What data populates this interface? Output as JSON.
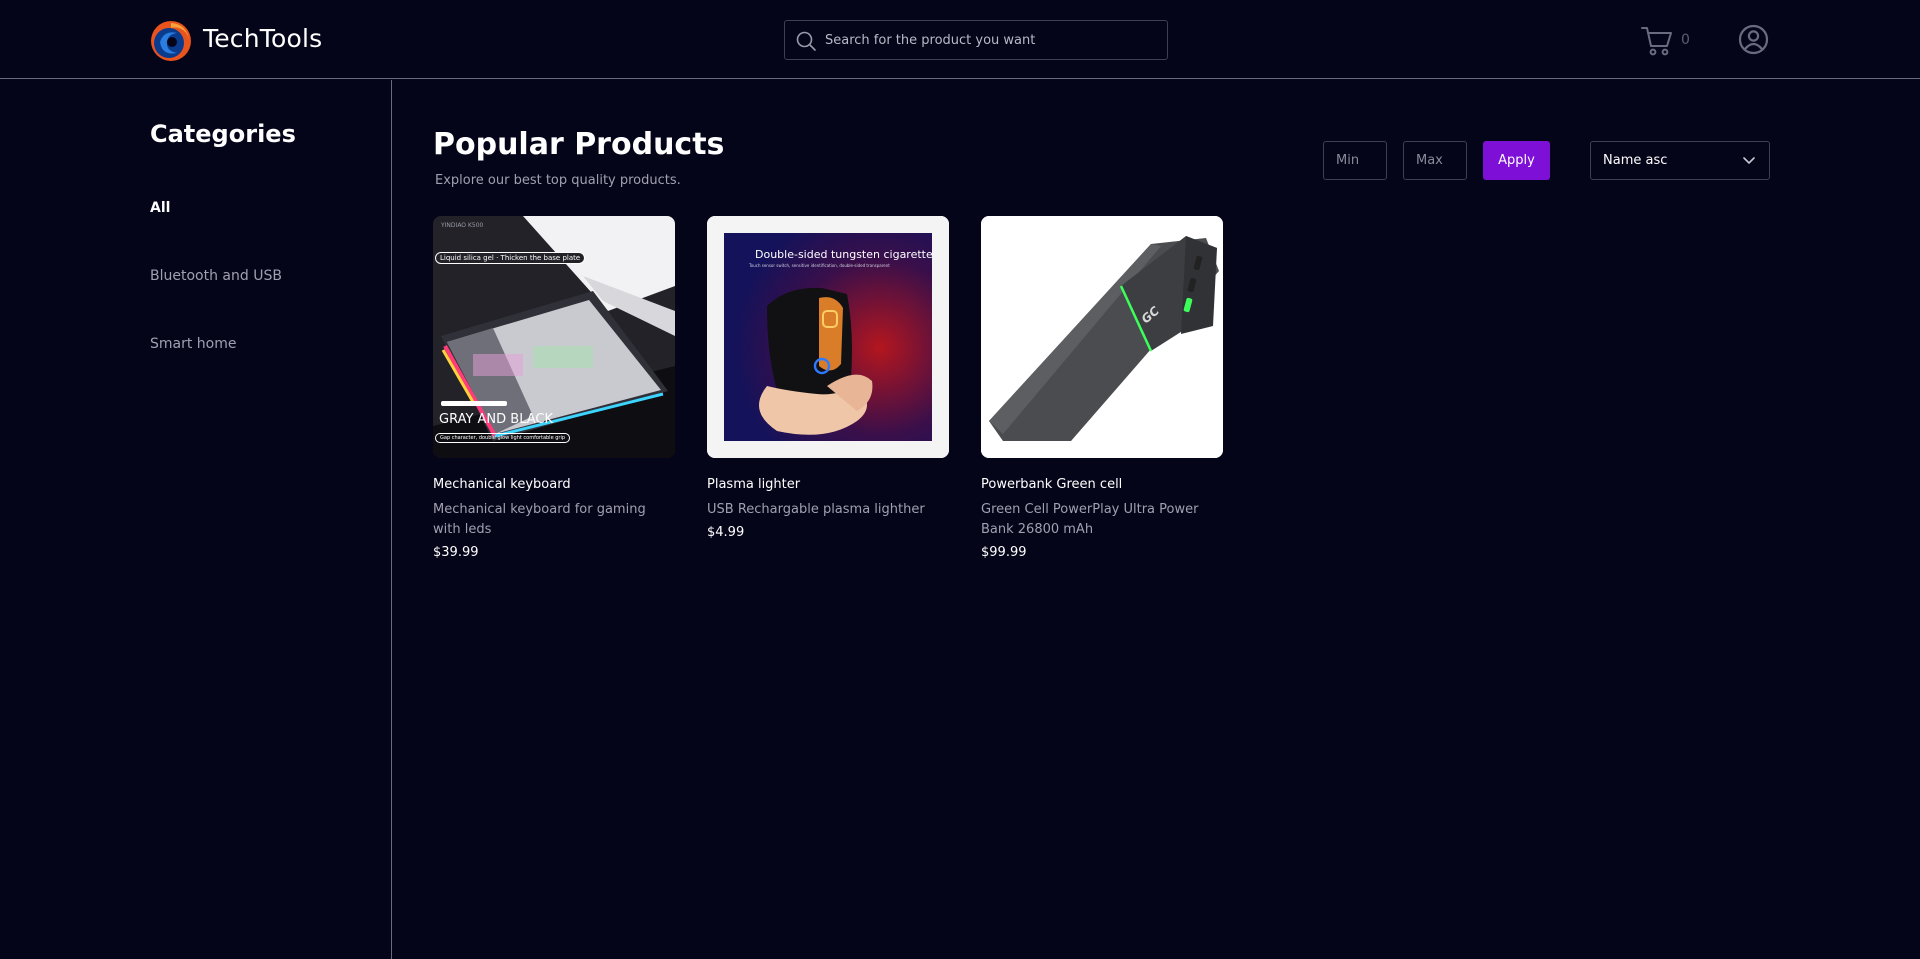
{
  "header": {
    "brand": "TechTools",
    "search": {
      "placeholder": "Search for the product you want",
      "value": ""
    },
    "cart_count": "0"
  },
  "sidebar": {
    "title": "Categories",
    "items": [
      {
        "label": "All",
        "active": true
      },
      {
        "label": "Bluetooth and USB",
        "active": false
      },
      {
        "label": "Smart home",
        "active": false
      }
    ]
  },
  "main": {
    "title": "Popular Products",
    "subtitle": "Explore our best top quality products.",
    "filters": {
      "min_placeholder": "Min",
      "max_placeholder": "Max",
      "apply_label": "Apply",
      "sort_label": "Name asc"
    },
    "products": [
      {
        "name": "Mechanical keyboard",
        "description": "Mechanical keyboard for gaming with leds",
        "price": "$39.99",
        "image_text": {
          "model": "YINDIAO K500",
          "tag": "Liquid silica gel · Thicken the base plate",
          "color_name": "GRAY AND BLACK",
          "note": "Gap character, double glow light comfortable grip"
        }
      },
      {
        "name": "Plasma lighter",
        "description": "USB Rechargable plasma lighther",
        "price": "$4.99",
        "image_text": {
          "headline": "Double-sided tungsten cigarette",
          "subline": "Touch sensor switch, sensitive identification, double-sided transparent"
        }
      },
      {
        "name": "Powerbank Green cell",
        "description": "Green Cell PowerPlay Ultra Power Bank 26800 mAh",
        "price": "$99.99",
        "image_text": {
          "logo": "GC"
        }
      }
    ]
  },
  "colors": {
    "background": "#05051a",
    "accent": "#7d0fd6",
    "border": "#3f3f52",
    "muted_text": "#a0a0b0"
  },
  "icons": [
    "logo-icon",
    "search-icon",
    "cart-icon",
    "account-icon",
    "chevron-down-icon"
  ]
}
